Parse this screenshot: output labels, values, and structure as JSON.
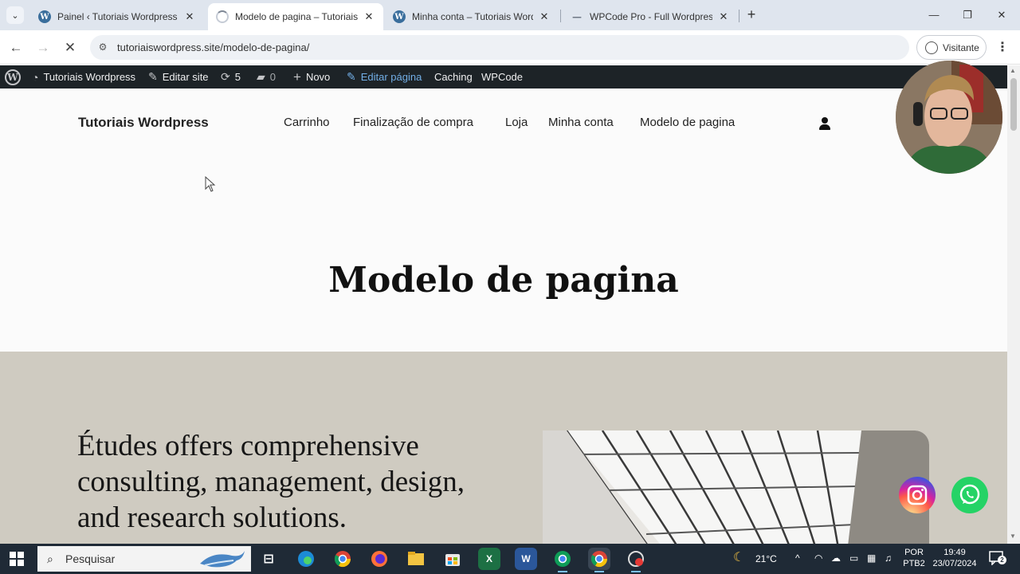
{
  "browser": {
    "tabs": [
      {
        "title": "Painel ‹ Tutoriais Wordpress — ",
        "favicon": "wordpress-icon",
        "active": false
      },
      {
        "title": "Modelo de pagina – Tutoriais W",
        "favicon": "loading-spinner-icon",
        "active": true
      },
      {
        "title": "Minha conta – Tutoriais WordP",
        "favicon": "wordpress-icon",
        "active": false
      },
      {
        "title": "WPCode Pro - Full Wordpress",
        "favicon": "dash-icon",
        "active": false
      }
    ],
    "url": "tutoriaiswordpress.site/modelo-de-pagina/",
    "profile_label": "Visitante"
  },
  "admin_bar": {
    "site_name": "Tutoriais Wordpress",
    "edit_site": "Editar site",
    "updates_count": "5",
    "comments_count": "0",
    "new_label": "Novo",
    "edit_page": "Editar página",
    "caching": "Caching",
    "wpcode": "WPCode"
  },
  "site": {
    "title": "Tutoriais Wordpress",
    "nav": [
      "Carrinho",
      "Finalização de compra",
      "Loja",
      "Minha conta",
      "Modelo de pagina"
    ]
  },
  "page": {
    "heading": "Modelo de pagina",
    "hero_text": "Études offers comprehensive consulting, management, design, and research solutions."
  },
  "taskbar": {
    "search_placeholder": "Pesquisar",
    "weather": "21°C",
    "language_top": "POR",
    "language_bottom": "PTB2",
    "time": "19:49",
    "date": "23/07/2024",
    "notification_count": "2"
  },
  "colors": {
    "admin_bar_bg": "#1d2327",
    "hero_bg": "#cfcbc1",
    "taskbar_bg": "#1f2a36",
    "whatsapp": "#25d366"
  }
}
